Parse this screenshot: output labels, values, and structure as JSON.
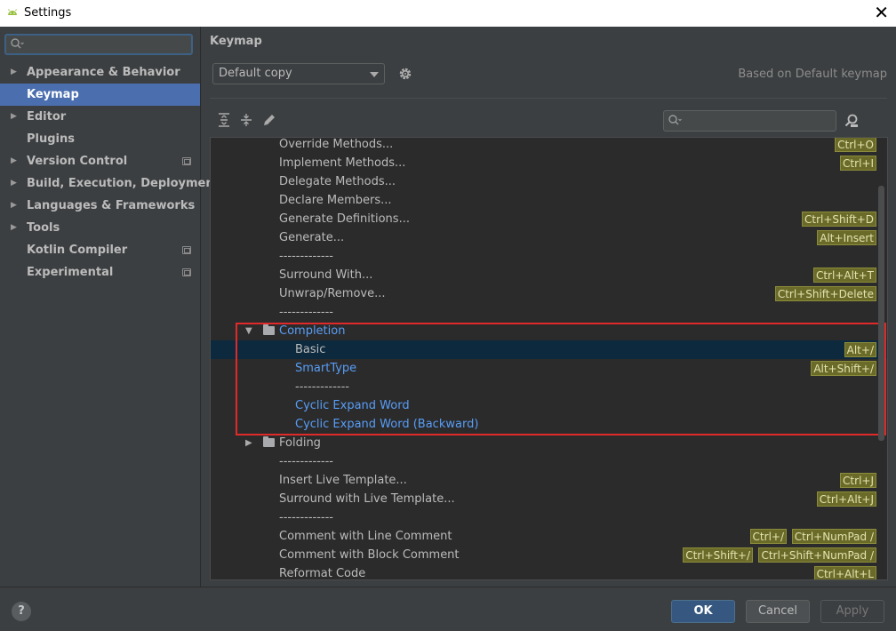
{
  "window": {
    "title": "Settings",
    "close_glyph": "✕"
  },
  "sidebar": {
    "search_placeholder": "",
    "items": [
      {
        "label": "Appearance & Behavior",
        "expandable": true,
        "project": false
      },
      {
        "label": "Keymap",
        "expandable": false,
        "project": false,
        "selected": true
      },
      {
        "label": "Editor",
        "expandable": true,
        "project": false
      },
      {
        "label": "Plugins",
        "expandable": false,
        "project": false
      },
      {
        "label": "Version Control",
        "expandable": true,
        "project": true
      },
      {
        "label": "Build, Execution, Deployment",
        "expandable": true,
        "project": false
      },
      {
        "label": "Languages & Frameworks",
        "expandable": true,
        "project": false
      },
      {
        "label": "Tools",
        "expandable": true,
        "project": false
      },
      {
        "label": "Kotlin Compiler",
        "expandable": false,
        "project": true
      },
      {
        "label": "Experimental",
        "expandable": false,
        "project": true
      }
    ]
  },
  "main": {
    "title": "Keymap",
    "keymap_value": "Default copy",
    "based_on": "Based on Default keymap",
    "tree_search_placeholder": "",
    "tree": [
      {
        "text": "Override Methods...",
        "level": 0,
        "shortcuts": [
          "Ctrl+O"
        ]
      },
      {
        "text": "Implement Methods...",
        "level": 0,
        "shortcuts": [
          "Ctrl+I"
        ]
      },
      {
        "text": "Delegate Methods...",
        "level": 0,
        "shortcuts": []
      },
      {
        "text": "Declare Members...",
        "level": 0,
        "shortcuts": []
      },
      {
        "text": "Generate Definitions...",
        "level": 0,
        "shortcuts": [
          "Ctrl+Shift+D"
        ]
      },
      {
        "text": "Generate...",
        "level": 0,
        "shortcuts": [
          "Alt+Insert"
        ]
      },
      {
        "text": "-------------",
        "level": 0,
        "shortcuts": []
      },
      {
        "text": "Surround With...",
        "level": 0,
        "shortcuts": [
          "Ctrl+Alt+T"
        ]
      },
      {
        "text": "Unwrap/Remove...",
        "level": 0,
        "shortcuts": [
          "Ctrl+Shift+Delete"
        ]
      },
      {
        "text": "-------------",
        "level": 0,
        "shortcuts": []
      },
      {
        "text": "Completion",
        "level": 0,
        "folder": true,
        "expanded": true,
        "link": true,
        "shortcuts": []
      },
      {
        "text": "Basic",
        "level": 1,
        "selected": true,
        "shortcuts": [
          "Alt+/"
        ]
      },
      {
        "text": "SmartType",
        "level": 1,
        "link": true,
        "shortcuts": [
          "Alt+Shift+/"
        ]
      },
      {
        "text": "-------------",
        "level": 1,
        "shortcuts": []
      },
      {
        "text": "Cyclic Expand Word",
        "level": 1,
        "link": true,
        "shortcuts": []
      },
      {
        "text": "Cyclic Expand Word (Backward)",
        "level": 1,
        "link": true,
        "shortcuts": []
      },
      {
        "text": "Folding",
        "level": 0,
        "folder": true,
        "expanded": false,
        "shortcuts": []
      },
      {
        "text": "-------------",
        "level": 0,
        "shortcuts": []
      },
      {
        "text": "Insert Live Template...",
        "level": 0,
        "shortcuts": [
          "Ctrl+J"
        ]
      },
      {
        "text": "Surround with Live Template...",
        "level": 0,
        "shortcuts": [
          "Ctrl+Alt+J"
        ]
      },
      {
        "text": "-------------",
        "level": 0,
        "shortcuts": []
      },
      {
        "text": "Comment with Line Comment",
        "level": 0,
        "shortcuts": [
          "Ctrl+/",
          "Ctrl+NumPad /"
        ]
      },
      {
        "text": "Comment with Block Comment",
        "level": 0,
        "shortcuts": [
          "Ctrl+Shift+/",
          "Ctrl+Shift+NumPad /"
        ]
      },
      {
        "text": "Reformat Code",
        "level": 0,
        "shortcuts": [
          "Ctrl+Alt+L"
        ]
      }
    ]
  },
  "footer": {
    "help": "?",
    "ok": "OK",
    "cancel": "Cancel",
    "apply": "Apply"
  },
  "colors": {
    "accent": "#4b6eaf",
    "link": "#589df6",
    "shortcut_bg": "#6b6b29",
    "highlight": "#e02a2a"
  }
}
